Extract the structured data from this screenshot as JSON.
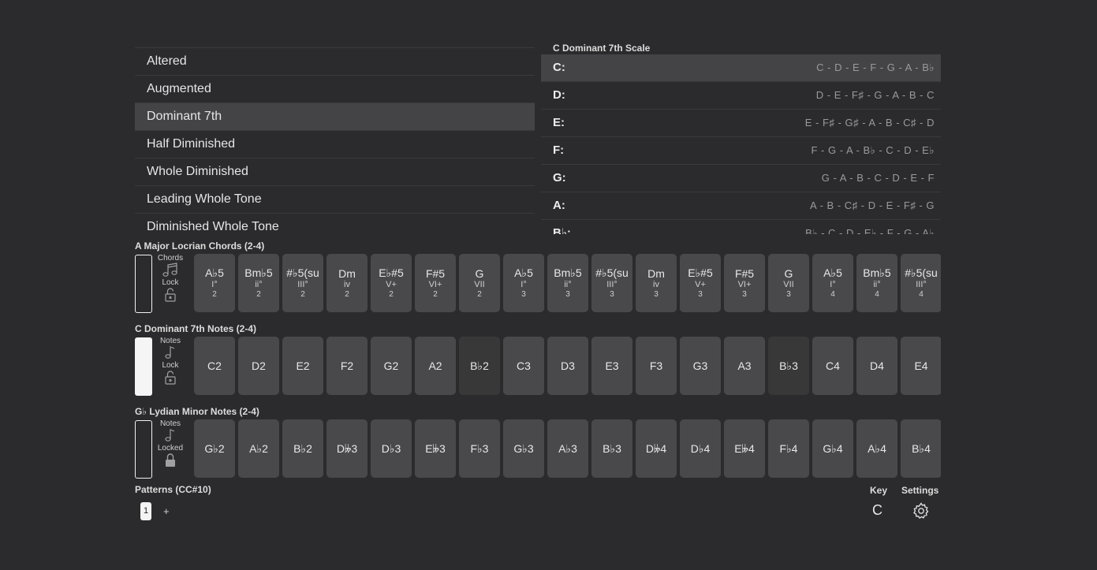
{
  "scale_types": {
    "items": [
      "Altered",
      "Augmented",
      "Dominant 7th",
      "Half Diminished",
      "Whole Diminished",
      "Leading Whole Tone",
      "Diminished Whole Tone"
    ],
    "selected_index": 2
  },
  "scale": {
    "title": "C Dominant 7th Scale",
    "rows": [
      {
        "key": "C:",
        "notes": "C - D - E - F - G - A - B♭"
      },
      {
        "key": "D:",
        "notes": "D - E - F♯ - G - A - B - C"
      },
      {
        "key": "E:",
        "notes": "E - F♯ - G♯ - A - B - C♯ - D"
      },
      {
        "key": "F:",
        "notes": "F - G - A - B♭ - C - D - E♭"
      },
      {
        "key": "G:",
        "notes": "G - A - B - C - D - E - F"
      },
      {
        "key": "A:",
        "notes": "A - B - C♯ - D - E - F♯ - G"
      },
      {
        "key": "B♭:",
        "notes": "B♭ - C - D - E♭ - F - G - A♭"
      }
    ],
    "selected_index": 0
  },
  "tracks": {
    "chords": {
      "title": "A Major Locrian Chords (2-4)",
      "ctrl_label": "Chords",
      "ctrl_icon": "music-notes-icon",
      "lock_label": "Lock",
      "lock_icon": "unlocked-icon",
      "keys": [
        {
          "name": "A♭5",
          "deg": "I°",
          "oct": "2"
        },
        {
          "name": "Bm♭5",
          "deg": "ii°",
          "oct": "2"
        },
        {
          "name": "#♭5(su",
          "deg": "III°",
          "oct": "2"
        },
        {
          "name": "Dm",
          "deg": "iv",
          "oct": "2"
        },
        {
          "name": "E♭#5",
          "deg": "V+",
          "oct": "2"
        },
        {
          "name": "F#5",
          "deg": "VI+",
          "oct": "2"
        },
        {
          "name": "G",
          "deg": "VII",
          "oct": "2"
        },
        {
          "name": "A♭5",
          "deg": "I°",
          "oct": "3"
        },
        {
          "name": "Bm♭5",
          "deg": "ii°",
          "oct": "3"
        },
        {
          "name": "#♭5(su",
          "deg": "III°",
          "oct": "3"
        },
        {
          "name": "Dm",
          "deg": "iv",
          "oct": "3"
        },
        {
          "name": "E♭#5",
          "deg": "V+",
          "oct": "3"
        },
        {
          "name": "F#5",
          "deg": "VI+",
          "oct": "3"
        },
        {
          "name": "G",
          "deg": "VII",
          "oct": "3"
        },
        {
          "name": "A♭5",
          "deg": "I°",
          "oct": "4"
        },
        {
          "name": "Bm♭5",
          "deg": "ii°",
          "oct": "4"
        },
        {
          "name": "#♭5(su",
          "deg": "III°",
          "oct": "4"
        }
      ]
    },
    "notes1": {
      "title": "C Dominant 7th Notes (2-4)",
      "ctrl_label": "Notes",
      "ctrl_icon": "music-note-icon",
      "lock_label": "Lock",
      "lock_icon": "unlocked-icon",
      "keys": [
        "C2",
        "D2",
        "E2",
        "F2",
        "G2",
        "A2",
        "B♭2",
        "C3",
        "D3",
        "E3",
        "F3",
        "G3",
        "A3",
        "B♭3",
        "C4",
        "D4",
        "E4"
      ],
      "dark_keys": [
        "B♭2",
        "B♭3"
      ]
    },
    "notes2": {
      "title": "G♭ Lydian Minor Notes (2-4)",
      "ctrl_label": "Notes",
      "ctrl_icon": "music-note-icon",
      "lock_label": "Locked",
      "lock_icon": "locked-icon",
      "keys": [
        "G♭2",
        "A♭2",
        "B♭2",
        "D𝄫3",
        "D♭3",
        "E𝄫3",
        "F♭3",
        "G♭3",
        "A♭3",
        "B♭3",
        "D𝄫4",
        "D♭4",
        "E𝄫4",
        "F♭4",
        "G♭4",
        "A♭4",
        "B♭4"
      ]
    }
  },
  "patterns": {
    "title": "Patterns (CC#10)",
    "current": "1",
    "add_label": "+"
  },
  "key": {
    "label": "Key",
    "value": "C"
  },
  "settings": {
    "label": "Settings",
    "icon": "gear-icon"
  },
  "colors": {
    "background": "#2b2b2d",
    "key": "#49494b",
    "key_dark": "#383839",
    "selected_row": "#444446"
  }
}
